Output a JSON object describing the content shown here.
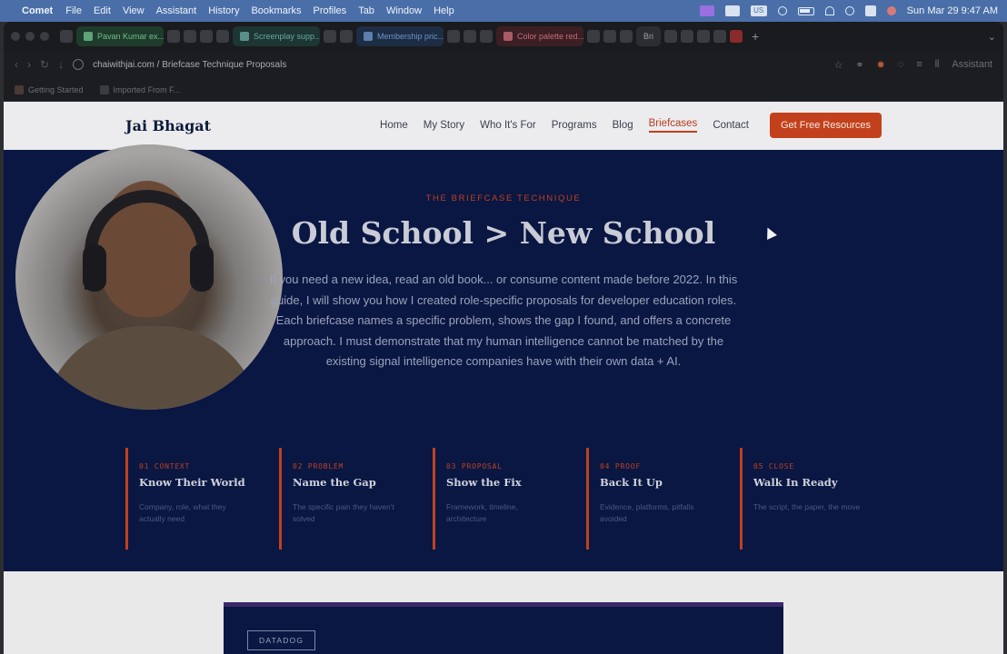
{
  "menubar": {
    "app": "Comet",
    "items": [
      "File",
      "Edit",
      "View",
      "Assistant",
      "History",
      "Bookmarks",
      "Profiles",
      "Tab",
      "Window",
      "Help"
    ],
    "status_badge": "US",
    "clock": "Sun Mar 29  9:47 AM"
  },
  "tabs": [
    {
      "label": "Pavan Kumar ex...",
      "tone": "green"
    },
    {
      "label": "Screenplay supp...",
      "tone": "teal"
    },
    {
      "label": "Membership pric...",
      "tone": "blue"
    },
    {
      "label": "Color palette red...",
      "tone": "red"
    },
    {
      "label": "Bri",
      "tone": "plain"
    }
  ],
  "address": {
    "url": "chaiwithjai.com / Briefcase Technique Proposals",
    "assistant": "Assistant"
  },
  "bookmarks": [
    "Getting Started",
    "Imported From F..."
  ],
  "site": {
    "brand": "Jai Bhagat",
    "nav": [
      "Home",
      "My Story",
      "Who It's For",
      "Programs",
      "Blog",
      "Briefcases",
      "Contact"
    ],
    "active_nav": "Briefcases",
    "cta": "Get Free Resources"
  },
  "hero": {
    "eyebrow": "THE BRIEFCASE TECHNIQUE",
    "headline": "Old School > New School",
    "lead": "If you need a new idea, read an old book... or consume content made before 2022. In this guide, I will show you how I created role-specific proposals for developer education roles. Each briefcase names a specific problem, shows the gap I found, and offers a concrete approach. I must demonstrate that my human intelligence cannot be matched by the existing signal intelligence companies have with their own data + AI."
  },
  "steps": [
    {
      "num": "01 CONTEXT",
      "title": "Know Their World",
      "desc": "Company, role, what they actually need"
    },
    {
      "num": "02 PROBLEM",
      "title": "Name the Gap",
      "desc": "The specific pain they haven't solved"
    },
    {
      "num": "03 PROPOSAL",
      "title": "Show the Fix",
      "desc": "Framework, timeline, architecture"
    },
    {
      "num": "04 PROOF",
      "title": "Back It Up",
      "desc": "Evidence, platforms, pitfalls avoided"
    },
    {
      "num": "05 CLOSE",
      "title": "Walk In Ready",
      "desc": "The script, the paper, the move"
    }
  ],
  "card": {
    "tag": "DATADOG"
  },
  "colors": {
    "accent": "#c0401e",
    "hero_bg": "#0a1742",
    "menubar": "#4a6fa8"
  }
}
